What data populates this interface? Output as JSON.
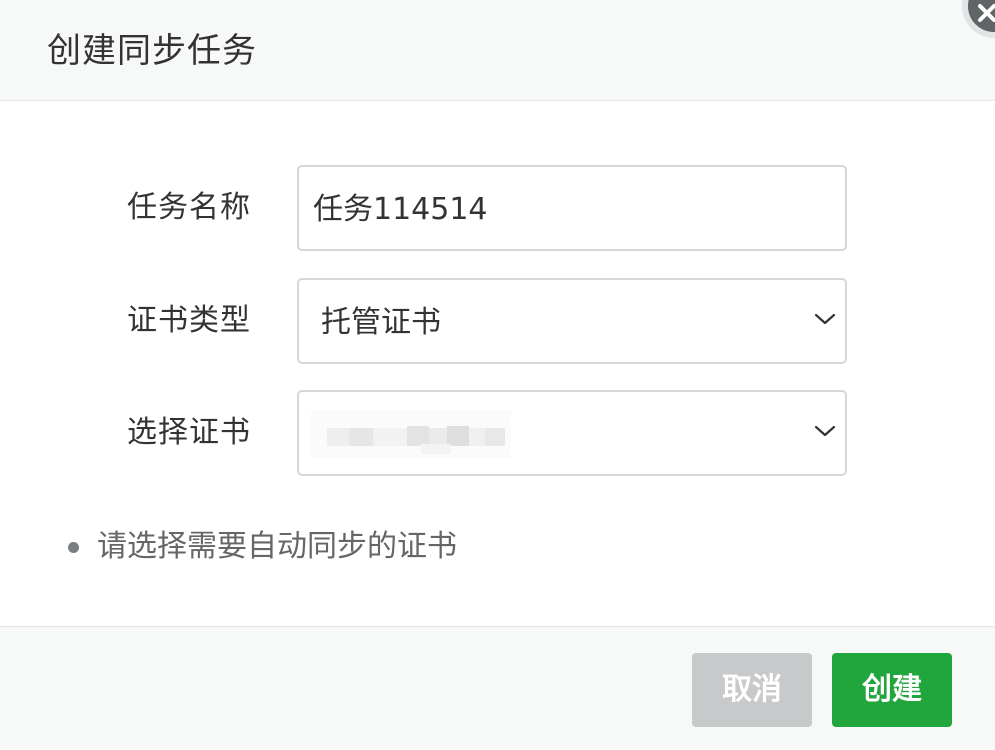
{
  "dialog": {
    "title": "创建同步任务"
  },
  "form": {
    "task_name": {
      "label": "任务名称",
      "value": "任务114514"
    },
    "cert_type": {
      "label": "证书类型",
      "selected": "托管证书"
    },
    "cert_select": {
      "label": "选择证书",
      "selected": ""
    }
  },
  "tip": {
    "text": "请选择需要自动同步的证书"
  },
  "footer": {
    "cancel_label": "取消",
    "create_label": "创建"
  },
  "icons": {
    "close": "close-icon",
    "dropdown": "chevron-down-icon"
  },
  "colors": {
    "primary_button": "#21a53d",
    "cancel_button": "#c8c9ca",
    "header_background": "#f7f8f8"
  }
}
